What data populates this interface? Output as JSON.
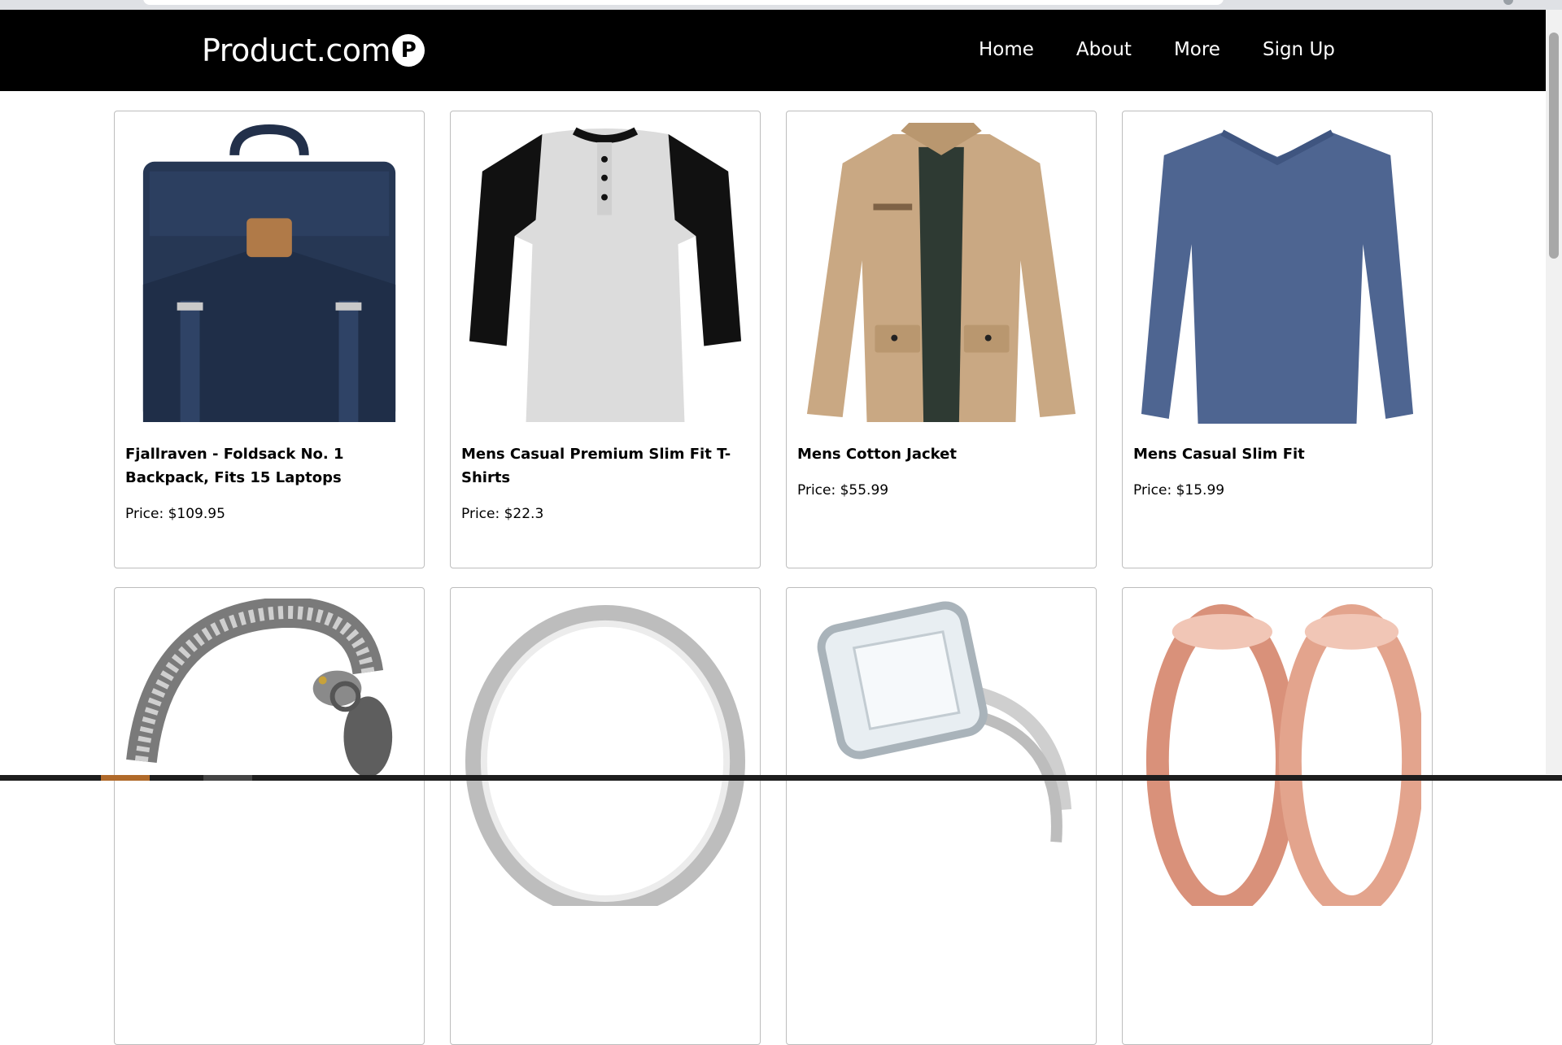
{
  "brand": {
    "name": "Product.com",
    "badge": "P"
  },
  "nav": [
    "Home",
    "About",
    "More",
    "Sign Up"
  ],
  "products": [
    {
      "title": "Fjallraven - Foldsack No. 1 Backpack, Fits 15 Laptops",
      "price": "Price: $109.95",
      "image": "navy-backpack"
    },
    {
      "title": "Mens Casual Premium Slim Fit T-Shirts",
      "price": "Price: $22.3",
      "image": "raglan-tshirt"
    },
    {
      "title": "Mens Cotton Jacket",
      "price": "Price: $55.99",
      "image": "khaki-jacket"
    },
    {
      "title": "Mens Casual Slim Fit",
      "price": "Price: $15.99",
      "image": "blue-longsleeve"
    },
    {
      "title": "",
      "price": "",
      "image": "dragon-bracelet"
    },
    {
      "title": "",
      "price": "",
      "image": "silver-ring"
    },
    {
      "title": "",
      "price": "",
      "image": "diamond-ring"
    },
    {
      "title": "",
      "price": "",
      "image": "rose-gold-plugs"
    }
  ]
}
